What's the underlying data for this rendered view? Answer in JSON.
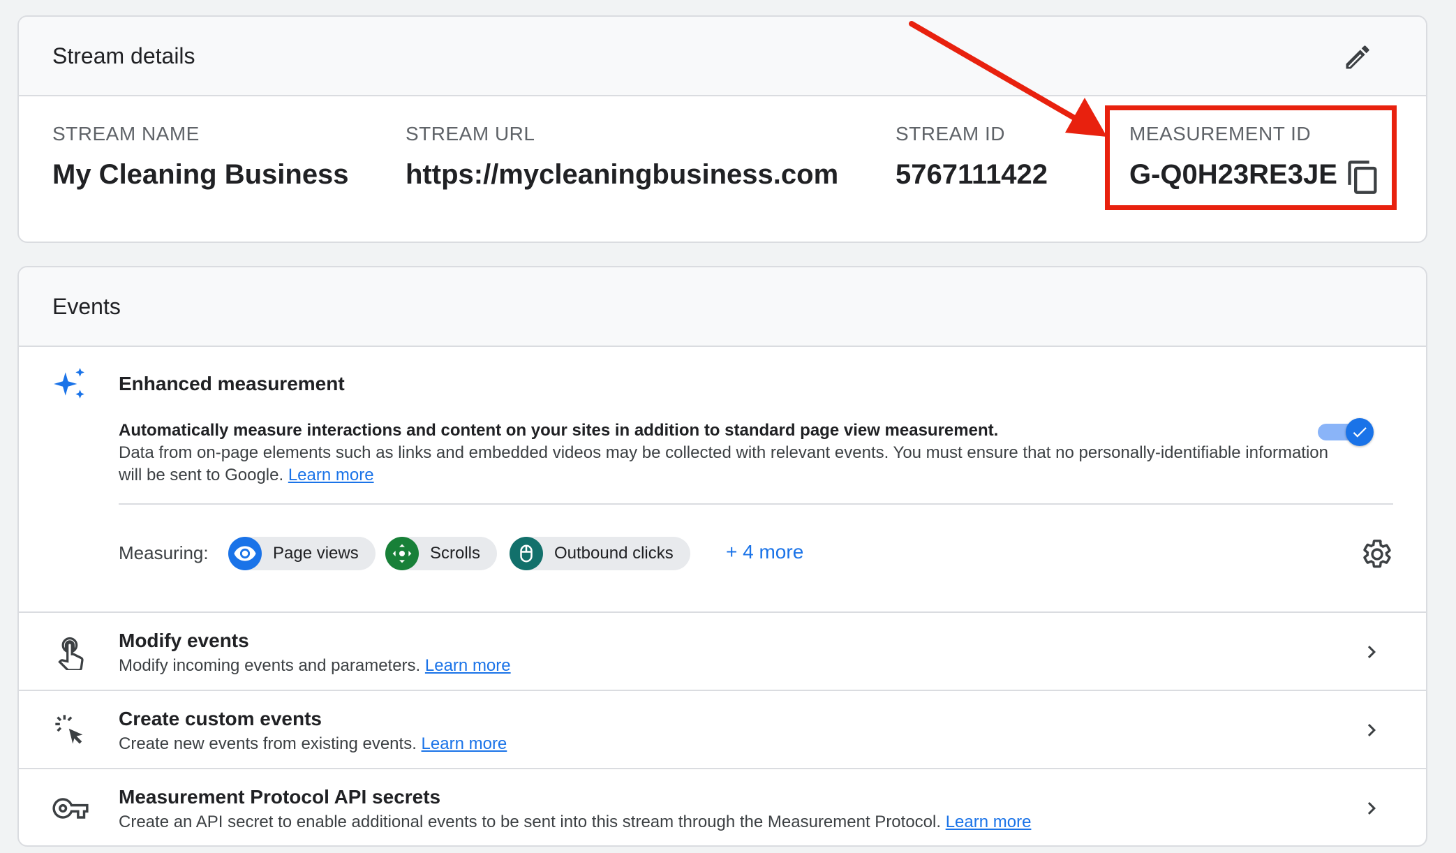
{
  "stream_details": {
    "header": "Stream details",
    "fields": [
      {
        "label": "STREAM NAME",
        "value": "My Cleaning Business"
      },
      {
        "label": "STREAM URL",
        "value": "https://mycleaningbusiness.com"
      },
      {
        "label": "STREAM ID",
        "value": "5767111422"
      },
      {
        "label": "MEASUREMENT ID",
        "value": "G-Q0H23RE3JE"
      }
    ]
  },
  "events": {
    "header": "Events",
    "enhanced_measurement": {
      "title": "Enhanced measurement",
      "desc_bold": "Automatically measure interactions and content on your sites in addition to standard page view measurement.",
      "desc": "Data from on-page elements such as links and embedded videos may be collected with relevant events. You must ensure that no personally-identifiable information will be sent to Google.",
      "learn_more": "Learn more",
      "toggle_on": true,
      "measuring_label": "Measuring:",
      "chips": [
        "Page views",
        "Scrolls",
        "Outbound clicks"
      ],
      "more": "+ 4 more"
    },
    "rows": [
      {
        "title": "Modify events",
        "desc": "Modify incoming events and parameters.",
        "link": "Learn more"
      },
      {
        "title": "Create custom events",
        "desc": "Create new events from existing events.",
        "link": "Learn more"
      },
      {
        "title": "Measurement Protocol API secrets",
        "desc": "Create an API secret to enable additional events to be sent into this stream through the Measurement Protocol.",
        "link": "Learn more"
      }
    ]
  },
  "colors": {
    "accent": "#1a73e8",
    "highlight": "#e8210e",
    "chip_page_views": "#1a73e8",
    "chip_scrolls": "#188038",
    "chip_outbound": "#12706b"
  },
  "icons": [
    "edit-icon",
    "copy-icon",
    "sparkle-icon",
    "check-icon",
    "eye-icon",
    "scroll-icon",
    "mouse-icon",
    "gear-icon",
    "touch-icon",
    "custom-events-icon",
    "key-icon",
    "chevron-right-icon"
  ]
}
